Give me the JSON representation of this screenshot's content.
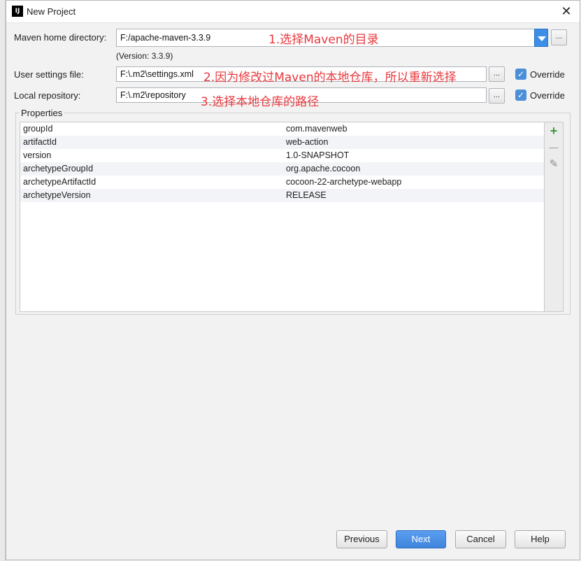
{
  "window": {
    "title": "New Project",
    "app_icon": "intellij-icon"
  },
  "maven_home": {
    "label": "Maven home directory:",
    "value": "F:/apache-maven-3.3.9",
    "version": "(Version: 3.3.9)",
    "annotation": "1.选择Maven的目录"
  },
  "user_settings": {
    "label": "User settings file:",
    "value": "F:\\.m2\\settings.xml",
    "annotation": "2.因为修改过Maven的本地仓库，所以重新选择",
    "override_label": "Override",
    "override_checked": true
  },
  "local_repo": {
    "label": "Local repository:",
    "value": "F:\\.m2\\repository",
    "annotation": "3.选择本地仓库的路径",
    "override_label": "Override",
    "override_checked": true
  },
  "browse_label": "...",
  "properties": {
    "title": "Properties",
    "rows": [
      {
        "key": "groupId",
        "value": "com.mavenweb"
      },
      {
        "key": "artifactId",
        "value": "web-action"
      },
      {
        "key": "version",
        "value": "1.0-SNAPSHOT"
      },
      {
        "key": "archetypeGroupId",
        "value": "org.apache.cocoon"
      },
      {
        "key": "archetypeArtifactId",
        "value": "cocoon-22-archetype-webapp"
      },
      {
        "key": "archetypeVersion",
        "value": "RELEASE"
      }
    ],
    "tools": {
      "add": "+",
      "remove": "—",
      "edit": "✎"
    }
  },
  "buttons": {
    "previous": "Previous",
    "next": "Next",
    "cancel": "Cancel",
    "help": "Help"
  },
  "colors": {
    "annotation": "#e8383d",
    "accent": "#3d8ee6",
    "add_icon": "#3a9a3a"
  }
}
